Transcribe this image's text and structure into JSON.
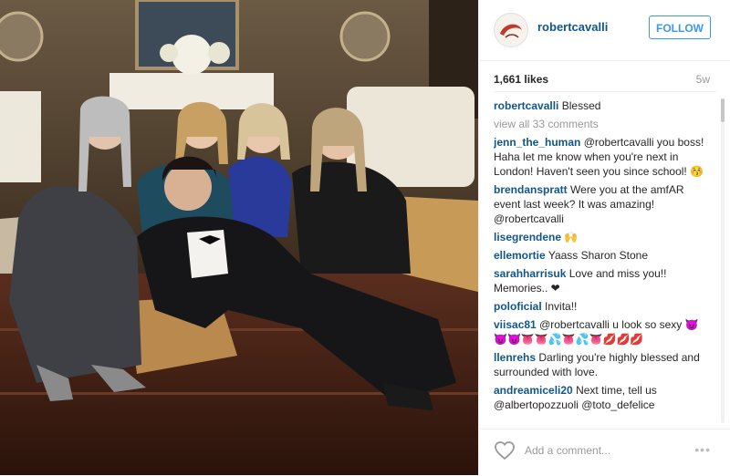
{
  "post": {
    "photo_alt": "photo of a group of people",
    "username": "robertcavalli",
    "follow_label": "FOLLOW",
    "likes": "1,661 likes",
    "age": "5w",
    "caption": {
      "user": "robertcavalli",
      "text": "Blessed"
    },
    "view_all": "view all 33 comments",
    "comments": [
      {
        "user": "jenn_the_human",
        "text": "@robertcavalli you boss! Haha let me know when you're next in London! Haven't seen you since school! 😚"
      },
      {
        "user": "brendanspratt",
        "text": "Were you at the amfAR event last week? It was amazing! @robertcavalli"
      },
      {
        "user": "lisegrendene",
        "text": "🙌"
      },
      {
        "user": "ellemortie",
        "text": "Yaass Sharon Stone"
      },
      {
        "user": "sarahharrisuk",
        "text": "Love and miss you!! Memories.. ❤"
      },
      {
        "user": "poloficial",
        "text": "Invita!!"
      },
      {
        "user": "viisac81",
        "text": "@robertcavalli u look so sexy 😈😈😈👅👅💦👅💦👅💋💋💋"
      },
      {
        "user": "llenrehs",
        "text": "Darling you're highly blessed and surrounded with love."
      },
      {
        "user": "andreamiceli20",
        "text": "Next time, tell us @albertopozzuoli @toto_defelice"
      }
    ],
    "add_comment_placeholder": "Add a comment...",
    "more_label": "•••"
  }
}
